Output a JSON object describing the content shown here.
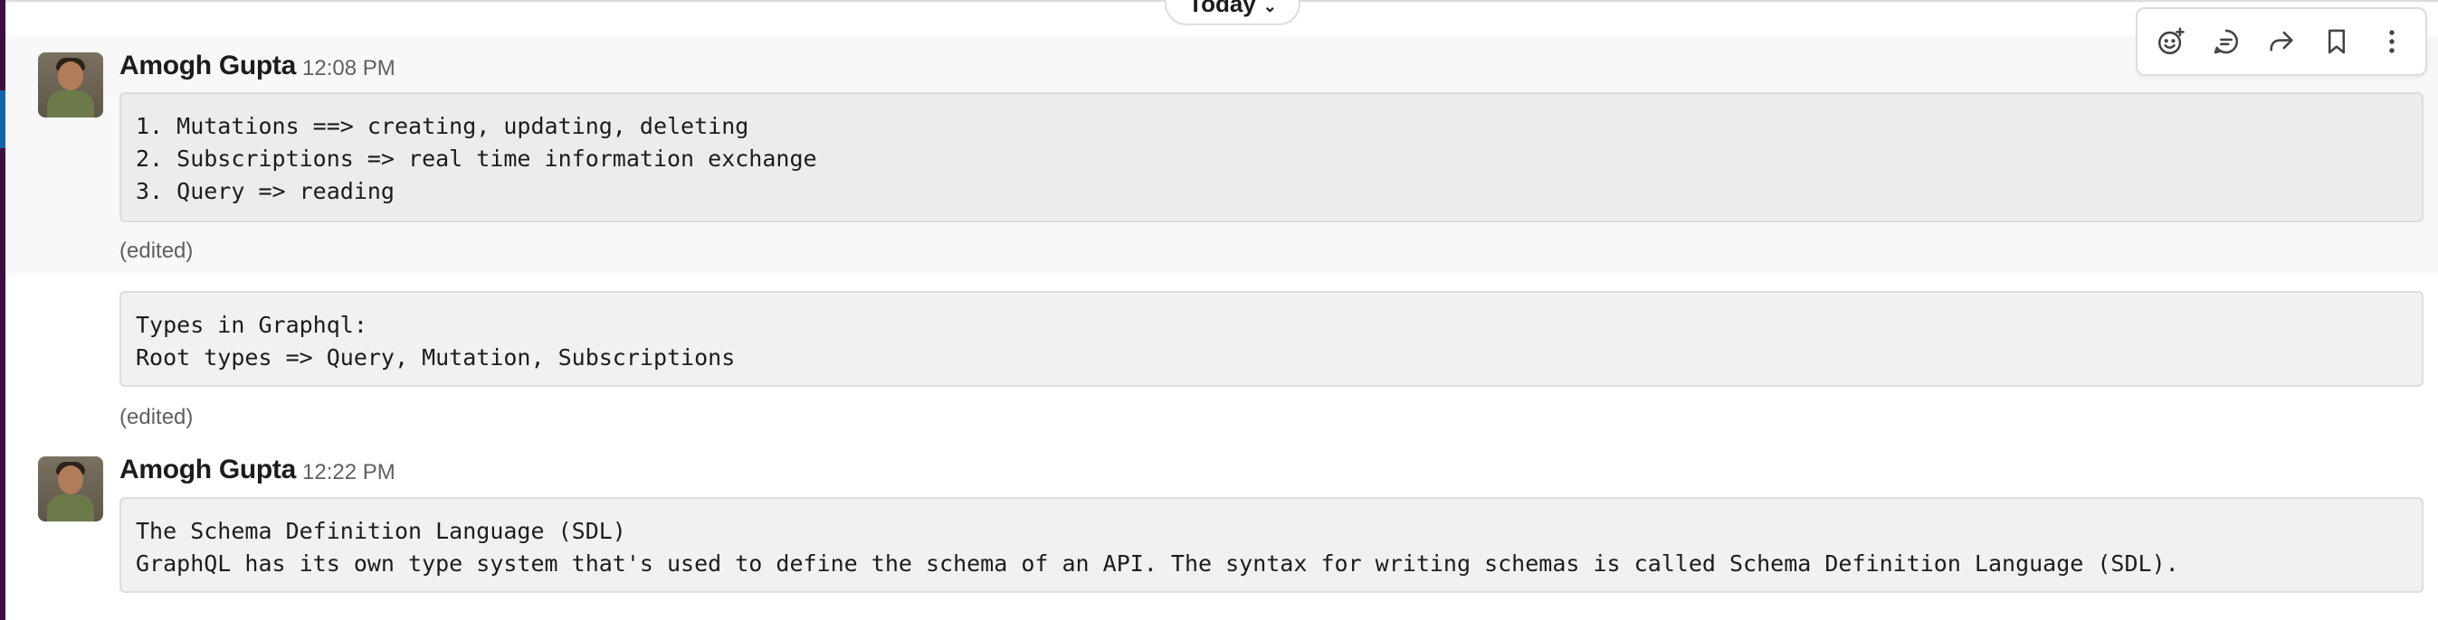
{
  "divider": {
    "label": "Today"
  },
  "messages": [
    {
      "author": "Amogh Gupta",
      "time": "12:08 PM",
      "code": "1. Mutations ==> creating, updating, deleting\n2. Subscriptions => real time information exchange\n3. Query => reading",
      "edited": "(edited)"
    },
    {
      "code": "Types in Graphql:\nRoot types => Query, Mutation, Subscriptions",
      "edited": "(edited)"
    },
    {
      "author": "Amogh Gupta",
      "time": "12:22 PM",
      "code": "The Schema Definition Language (SDL)\nGraphQL has its own type system that's used to define the schema of an API. The syntax for writing schemas is called Schema Definition Language (SDL)."
    }
  ],
  "message_actions": [
    {
      "icon": "add-reaction-icon"
    },
    {
      "icon": "reply-in-thread-icon"
    },
    {
      "icon": "forward-message-icon"
    },
    {
      "icon": "save-for-later-icon"
    },
    {
      "icon": "more-actions-icon"
    }
  ],
  "colors": {
    "sidebar": "#3f0e40",
    "accent": "#1264a3",
    "hover_bg": "#f8f8f8",
    "code_bg": "#f1f1f1",
    "muted_text": "#616061"
  }
}
